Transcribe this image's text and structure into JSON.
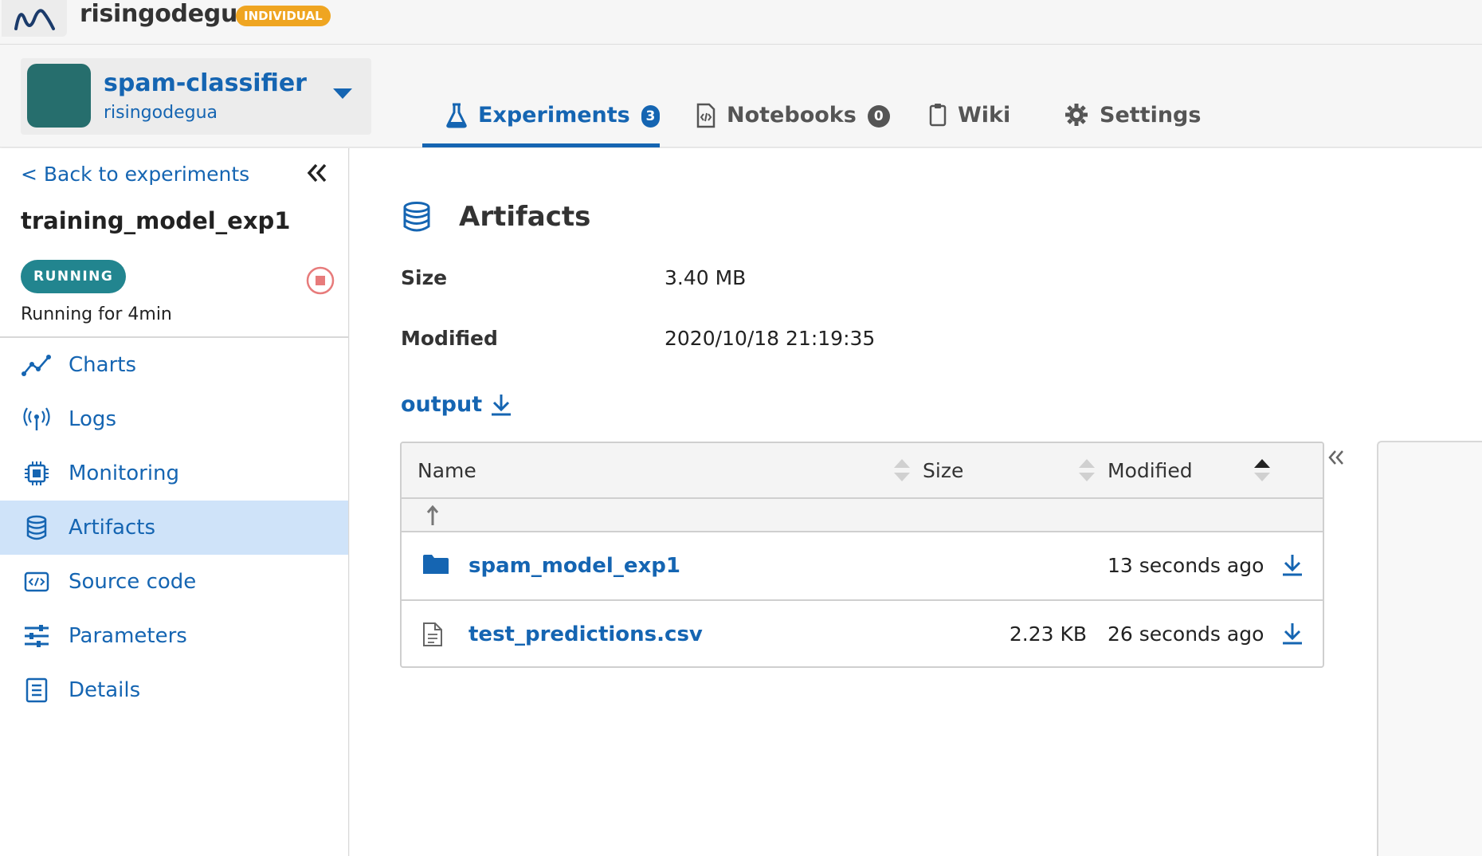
{
  "org": {
    "name": "risingodegua",
    "plan_badge": "INDIVIDUAL"
  },
  "project": {
    "name": "spam-classifier",
    "owner": "risingodegua"
  },
  "tabs": [
    {
      "label": "Experiments",
      "count": "3",
      "icon": "flask-icon",
      "active": true
    },
    {
      "label": "Notebooks",
      "count": "0",
      "icon": "notebook-icon",
      "active": false
    },
    {
      "label": "Wiki",
      "icon": "clipboard-icon",
      "active": false
    },
    {
      "label": "Settings",
      "icon": "gear-icon",
      "active": false
    }
  ],
  "sidebar": {
    "back_label": "< Back to experiments",
    "experiment_name": "training_model_exp1",
    "status": "RUNNING",
    "running_for": "Running for 4min",
    "items": [
      {
        "label": "Charts",
        "icon": "chart-line-icon"
      },
      {
        "label": "Logs",
        "icon": "broadcast-icon"
      },
      {
        "label": "Monitoring",
        "icon": "cpu-chip-icon"
      },
      {
        "label": "Artifacts",
        "icon": "database-icon",
        "active": true
      },
      {
        "label": "Source code",
        "icon": "code-icon"
      },
      {
        "label": "Parameters",
        "icon": "sliders-icon"
      },
      {
        "label": "Details",
        "icon": "list-doc-icon"
      }
    ]
  },
  "artifacts": {
    "title": "Artifacts",
    "size_label": "Size",
    "size_value": "3.40 MB",
    "modified_label": "Modified",
    "modified_value": "2020/10/18 21:19:35",
    "folder_link": "output",
    "table": {
      "columns": [
        "Name",
        "Size",
        "Modified"
      ],
      "rows": [
        {
          "type": "folder",
          "name": "spam_model_exp1",
          "size": "",
          "modified": "13 seconds ago"
        },
        {
          "type": "file",
          "name": "test_predictions.csv",
          "size": "2.23 KB",
          "modified": "26 seconds ago"
        }
      ]
    }
  },
  "colors": {
    "accent": "#1565b2",
    "badge": "#efa521",
    "status": "#22858f",
    "avatar": "#266e6d",
    "active_nav": "#cfe3f9"
  }
}
